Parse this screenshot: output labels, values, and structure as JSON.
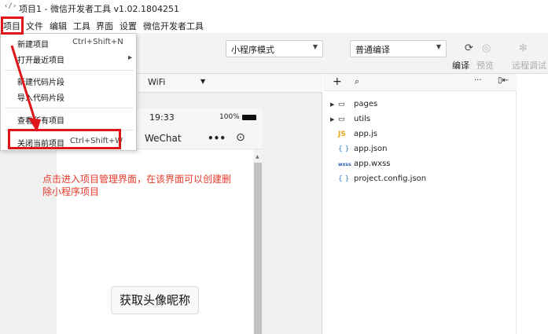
{
  "window": {
    "title": "项目1 - 微信开发者工具 v1.02.1804251"
  },
  "menubar": {
    "items": [
      "项目",
      "文件",
      "编辑",
      "工具",
      "界面",
      "设置",
      "微信开发者工具"
    ]
  },
  "toolbar": {
    "mode_select": "小程序模式",
    "compile_select": "普通编译",
    "compile_label": "编译",
    "preview_label": "预览",
    "remote_debug_label": "远程调试"
  },
  "simulator": {
    "network": "WiFi",
    "time": "19:33",
    "battery": "100%",
    "nav_title": "WeChat",
    "avatar_button": "获取头像昵称"
  },
  "dropdown": {
    "items": [
      {
        "label": "新建项目",
        "shortcut": "Ctrl+Shift+N"
      },
      {
        "label": "打开最近项目",
        "submenu": "▸"
      },
      {
        "label": "新建代码片段"
      },
      {
        "label": "导入代码片段"
      },
      {
        "label": "查看所有项目"
      },
      {
        "label": "关闭当前项目",
        "shortcut": "Ctrl+Shift+W"
      }
    ]
  },
  "file_tree": {
    "header": {
      "add": "+",
      "search": "🔍",
      "more": "···"
    },
    "items": [
      {
        "name": "pages",
        "type": "folder",
        "icon": "▢"
      },
      {
        "name": "utils",
        "type": "folder",
        "icon": "▢"
      },
      {
        "name": "app.js",
        "type": "js",
        "icon": "JS"
      },
      {
        "name": "app.json",
        "type": "json",
        "icon": "{ }"
      },
      {
        "name": "app.wxss",
        "type": "wxss",
        "icon": "wxss"
      },
      {
        "name": "project.config.json",
        "type": "json",
        "icon": "{ }"
      }
    ]
  },
  "annotation": {
    "text": "点击进入项目管理界面，在该界面可以创建删除小程序项目"
  },
  "colors": {
    "annotation_red": "#e0161b",
    "js_icon": "#e6a817",
    "json_icon": "#2a7fd4",
    "wxss_icon": "#2a5db0"
  }
}
